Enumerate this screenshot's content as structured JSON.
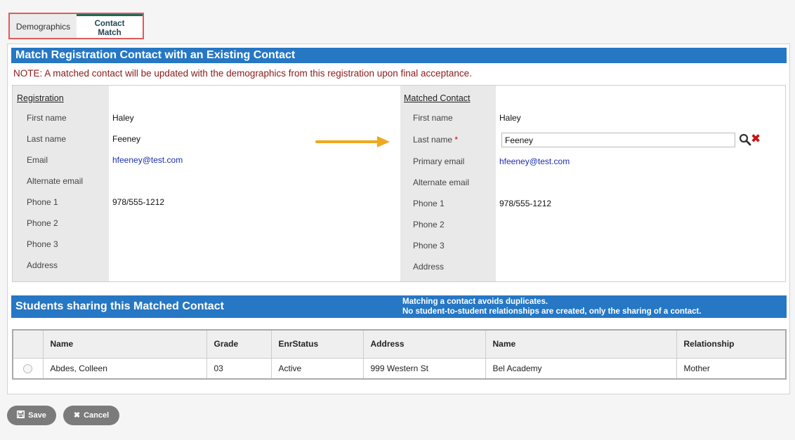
{
  "tabs": [
    {
      "label": "Demographics"
    },
    {
      "label_line1": "Contact",
      "label_line2": "Match"
    }
  ],
  "header": {
    "title": "Match Registration Contact with an Existing Contact",
    "note": "NOTE: A matched contact will be updated with the demographics from this registration upon final acceptance."
  },
  "registration": {
    "heading": "Registration",
    "fields": [
      {
        "label": "First name",
        "value": "Haley"
      },
      {
        "label": "Last name",
        "value": "Feeney"
      },
      {
        "label": "Email",
        "value": "hfeeney@test.com"
      },
      {
        "label": "Alternate email",
        "value": ""
      },
      {
        "label": "Phone 1",
        "value": "978/555-1212"
      },
      {
        "label": "Phone 2",
        "value": ""
      },
      {
        "label": "Phone 3",
        "value": ""
      },
      {
        "label": "Address",
        "value": ""
      }
    ]
  },
  "matched": {
    "heading": "Matched Contact",
    "required_marker": "*",
    "fields": [
      {
        "label": "First name",
        "value": "Haley"
      },
      {
        "label": "Last name",
        "value": "Feeney"
      },
      {
        "label": "Primary email",
        "value": "hfeeney@test.com"
      },
      {
        "label": "Alternate email",
        "value": ""
      },
      {
        "label": "Phone 1",
        "value": "978/555-1212"
      },
      {
        "label": "Phone 2",
        "value": ""
      },
      {
        "label": "Phone 3",
        "value": ""
      },
      {
        "label": "Address",
        "value": ""
      }
    ]
  },
  "students": {
    "title": "Students sharing this Matched Contact",
    "message_line1": "Matching a contact avoids duplicates.",
    "message_line2": "No student-to-student relationships are created, only the sharing of a contact.",
    "columns": [
      "Name",
      "Grade",
      "EnrStatus",
      "Address",
      "Name",
      "Relationship"
    ],
    "rows": [
      {
        "name": "Abdes, Colleen",
        "grade": "03",
        "status": "Active",
        "address": "999 Western St",
        "school": "Bel Academy",
        "relationship": "Mother"
      }
    ]
  },
  "buttons": {
    "save": "Save",
    "cancel": "Cancel"
  },
  "colors": {
    "bar": "#2677c4",
    "note": "#8b1a1a",
    "arrow": "#f0a81e",
    "clear": "#cc1111",
    "tab_highlight": "#e05a5a"
  }
}
